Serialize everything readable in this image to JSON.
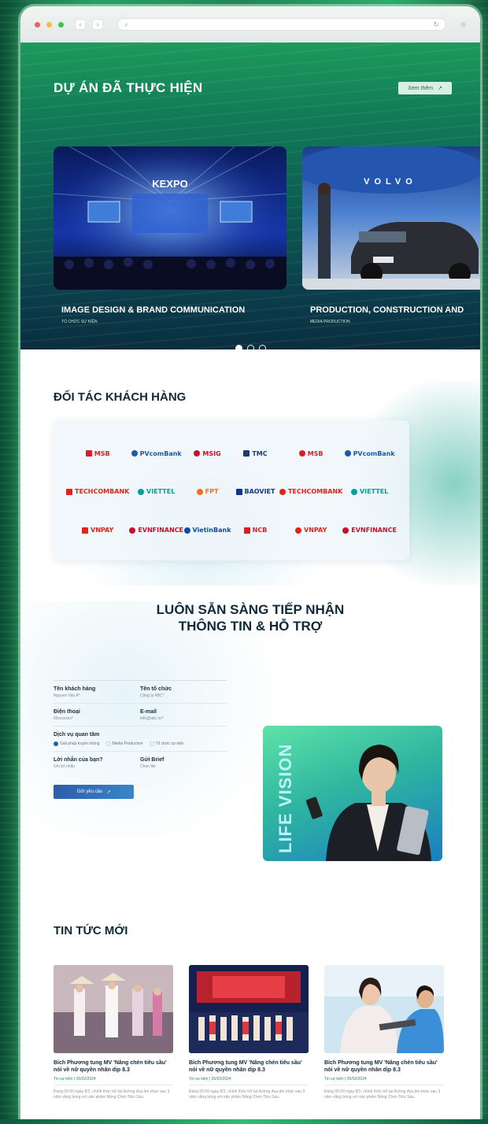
{
  "browser": {
    "reload_icon": "reload-icon",
    "menu_icon": "hamburger-icon"
  },
  "projects": {
    "title": "DỰ ÁN ĐÃ THỰC HIỆN",
    "see_more": "Xem thêm",
    "see_more_icon": "↗",
    "cards": [
      {
        "title": "IMAGE DESIGN & BRAND COMMUNICATION",
        "subtitle": "TỔ CHỨC SỰ KIỆN",
        "image_text": "KEXPO"
      },
      {
        "title": "PRODUCTION, CONSTRUCTION AND",
        "subtitle": "MEDIA PRODUCTION",
        "image_text": "VOLVO"
      }
    ],
    "pagination": {
      "count": 3,
      "active": 0
    }
  },
  "partners": {
    "title": "ĐỐI TÁC KHÁCH HÀNG",
    "logos": [
      {
        "name": "MSB",
        "color": "#d81f26"
      },
      {
        "name": "PVcomBank",
        "color": "#1d5aa8"
      },
      {
        "name": "MSIG",
        "color": "#c8102e"
      },
      {
        "name": "TMC",
        "color": "#1c3b6b"
      },
      {
        "name": "MSB",
        "color": "#d81f26"
      },
      {
        "name": "PVcomBank",
        "color": "#1d5aa8"
      },
      {
        "name": "TECHCOMBANK",
        "color": "#e2231a"
      },
      {
        "name": "VIETTEL",
        "color": "#00a19a"
      },
      {
        "name": "FPT",
        "color": "#f36f21"
      },
      {
        "name": "BAOVIET",
        "color": "#0b3a8c"
      },
      {
        "name": "TECHCOMBANK",
        "color": "#e2231a"
      },
      {
        "name": "VIETTEL",
        "color": "#00a19a"
      },
      {
        "name": "VNPAY",
        "color": "#e2231a"
      },
      {
        "name": "EVNFINANCE",
        "color": "#c8102e"
      },
      {
        "name": "VietinBank",
        "color": "#0c4da2"
      },
      {
        "name": "NCB",
        "color": "#d81f26"
      },
      {
        "name": "VNPAY",
        "color": "#e2231a"
      },
      {
        "name": "EVNFINANCE",
        "color": "#c8102e"
      }
    ]
  },
  "contact": {
    "title_line1": "LUÔN SẴN SÀNG TIẾP NHẬN",
    "title_line2": "THÔNG TIN & HỖ TRỢ",
    "fields": {
      "name_label": "Tên khách hàng",
      "name_placeholder": "Nguyen Van A*",
      "org_label": "Tên tổ chức",
      "org_placeholder": "Công ty ABC*",
      "phone_label": "Điện thoại",
      "phone_placeholder": "09xxxxxxx*",
      "email_label": "E-mail",
      "email_placeholder": "info@abc.vn*",
      "service_label": "Dịch vụ quan tâm",
      "service_options": [
        "Giải pháp truyền thông",
        "Media Production",
        "Tổ chức sự kiện"
      ],
      "service_selected": 0,
      "message_label": "Lời nhắn của bạn?",
      "message_placeholder": "Ghi lời nhắn",
      "brief_label": "Gửi Brief",
      "brief_placeholder": "Chọn file"
    },
    "submit_label": "Gửi yêu cầu",
    "submit_icon": "↗",
    "side_card_text": "LIFE VISION"
  },
  "news": {
    "title": "TIN TỨC MỚI",
    "items": [
      {
        "title": "Bích Phương tung MV 'Nâng chén tiêu sầu' nói về nữ quyền nhân dịp 8.3",
        "meta": "Tin sự kiện | 26/02/2024",
        "desc": "Đúng 00:00 ngày 8/3, chính thức trở lại đường đua âm nhạc sau 3 năm vắng bóng với sản phẩm Nâng Chén Tiêu Sầu."
      },
      {
        "title": "Bích Phương tung MV 'Nâng chén tiêu sầu' nói về nữ quyền nhân dịp 8.3",
        "meta": "Tin sự kiện | 26/02/2024",
        "desc": "Đúng 00:00 ngày 8/3, chính thức trở lại đường đua âm nhạc sau 3 năm vắng bóng với sản phẩm Nâng Chén Tiêu Sầu."
      },
      {
        "title": "Bích Phương tung MV 'Nâng chén tiêu sầu' nói về nữ quyền nhân dịp 8.3",
        "meta": "Tin sự kiện | 26/02/2024",
        "desc": "Đúng 00:00 ngày 8/3, chính thức trở lại đường đua âm nhạc sau 3 năm vắng bóng với sản phẩm Nâng Chén Tiêu Sầu."
      }
    ],
    "pagination": {
      "count": 3,
      "active": 0
    }
  },
  "colors": {
    "accent_green": "#1d9a5c",
    "dark_navy": "#0f2a3a",
    "button_blue": "#2b5ea9"
  }
}
